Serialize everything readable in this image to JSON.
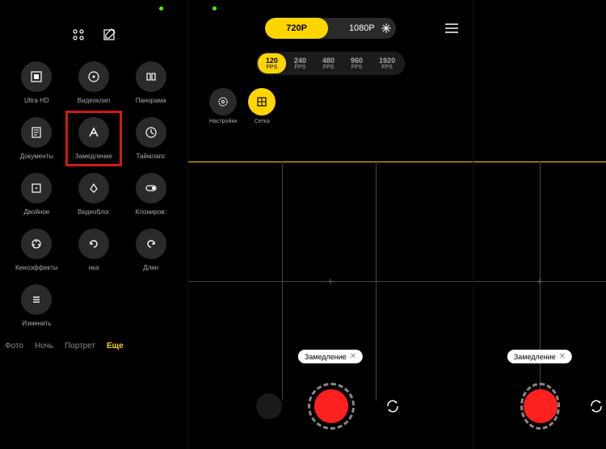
{
  "modes": [
    {
      "label": "Ultra HD",
      "icon": "ultra-hd"
    },
    {
      "label": "Видеоклип",
      "icon": "dot-circle"
    },
    {
      "label": "Панорама",
      "icon": "panorama"
    },
    {
      "label": "Документы",
      "icon": "document"
    },
    {
      "label": "Замедление",
      "icon": "slowmo"
    },
    {
      "label": "Таймлапс",
      "icon": "timelapse"
    },
    {
      "label": "Двойное",
      "icon": "dual"
    },
    {
      "label": "Видеоблог",
      "icon": "vlog"
    },
    {
      "label": "Клониров:",
      "icon": "clone"
    },
    {
      "label": "Киноэффекты",
      "icon": "cinema"
    },
    {
      "label": "нка",
      "icon": "reverse"
    },
    {
      "label": "Длин",
      "icon": "long"
    },
    {
      "label": "Изменить",
      "icon": "edit-list"
    }
  ],
  "tabs": [
    "Фото",
    "Ночь",
    "Портрет",
    "Еще"
  ],
  "active_tab": "Еще",
  "resolution": {
    "options": [
      "720P",
      "1080P"
    ],
    "active": "720P"
  },
  "fps": {
    "options": [
      "120",
      "240",
      "480",
      "960",
      "1920"
    ],
    "label": "FPS",
    "active": "120"
  },
  "settings": [
    {
      "label": "Настройки",
      "icon": "gear"
    },
    {
      "label": "Сетка",
      "icon": "grid",
      "active": true
    }
  ],
  "chip_label": "Замедление",
  "highlighted_mode": 4
}
